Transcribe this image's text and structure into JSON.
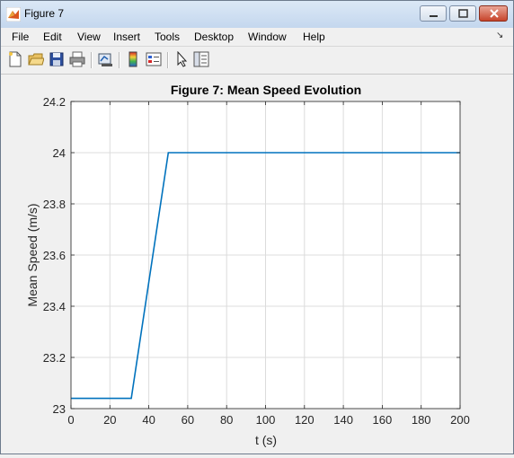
{
  "window": {
    "title": "Figure 7"
  },
  "menu": {
    "items": [
      "File",
      "Edit",
      "View",
      "Insert",
      "Tools",
      "Desktop",
      "Window",
      "Help"
    ],
    "corner_glyph": "↘"
  },
  "toolbar": {
    "tools": [
      "new-figure-icon",
      "open-icon",
      "save-icon",
      "print-icon",
      "link-plot-icon",
      "colorbar-icon",
      "legend-icon",
      "pointer-icon",
      "property-editor-icon"
    ]
  },
  "chart_data": {
    "type": "line",
    "title": "Figure 7: Mean Speed Evolution",
    "xlabel": "t (s)",
    "ylabel": "Mean Speed (m/s)",
    "xlim": [
      0,
      200
    ],
    "ylim": [
      23,
      24.2
    ],
    "xticks": [
      0,
      20,
      40,
      60,
      80,
      100,
      120,
      140,
      160,
      180,
      200
    ],
    "yticks": [
      23,
      23.2,
      23.4,
      23.6,
      23.8,
      24,
      24.2
    ],
    "ytick_labels": [
      "23",
      "23.2",
      "23.4",
      "23.6",
      "23.8",
      "24",
      "24.2"
    ],
    "grid": true,
    "series": [
      {
        "color": "#0072bd",
        "x": [
          0,
          31,
          50,
          200
        ],
        "y": [
          23.04,
          23.04,
          24.0,
          24.0
        ]
      }
    ]
  }
}
